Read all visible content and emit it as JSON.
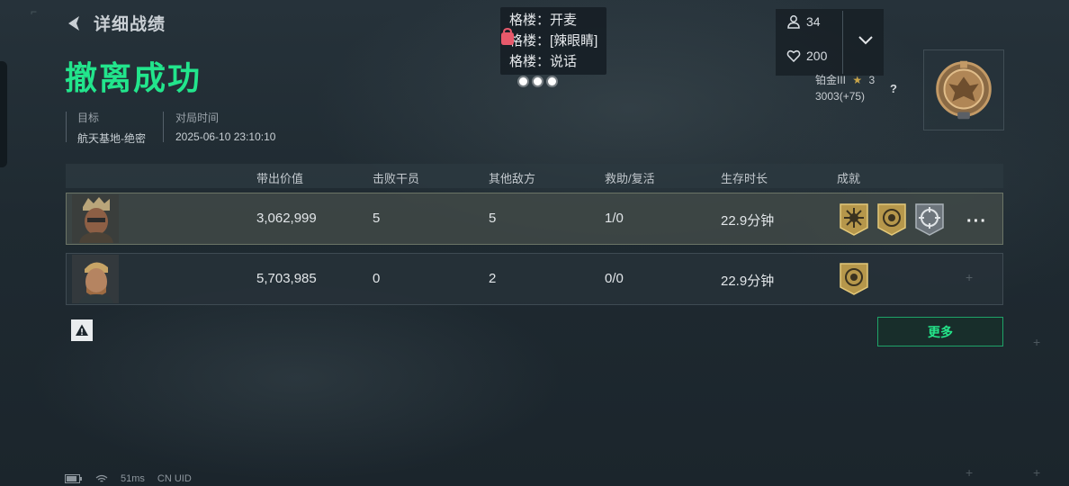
{
  "header": {
    "back_title": "详细战绩",
    "result": "撤离成功"
  },
  "meta": {
    "target_label": "目标",
    "target_value": "航天基地-绝密",
    "time_label": "对局时间",
    "time_value": "2025-06-10 23:10:10"
  },
  "chat": {
    "lines": [
      "格楼：开麦",
      "格楼：[辣眼睛]",
      "格楼：说话"
    ]
  },
  "social": {
    "players": "34",
    "likes": "200"
  },
  "rank": {
    "tier": "铂金III",
    "stars": "3",
    "score": "3003(+75)",
    "help": "?"
  },
  "table": {
    "headers": [
      "带出价值",
      "击败干员",
      "其他敌方",
      "救助/复活",
      "生存时长",
      "成就"
    ],
    "rows": [
      {
        "value": "3,062,999",
        "kills": "5",
        "others": "5",
        "assists": "1/0",
        "survival": "22.9分钟"
      },
      {
        "value": "5,703,985",
        "kills": "0",
        "others": "2",
        "assists": "0/0",
        "survival": "22.9分钟"
      }
    ]
  },
  "buttons": {
    "more": "更多",
    "row_menu": "···"
  },
  "footer": {
    "ping": "51ms",
    "uid": "CN UID"
  },
  "colors": {
    "accent": "#22e58c",
    "gold": "#c9a54a"
  },
  "icons": [
    "back-arrow-icon",
    "person-icon",
    "heart-icon",
    "chevron-down-icon",
    "star-icon",
    "medal-icon",
    "warning-icon",
    "wifi-icon",
    "battery-icon"
  ]
}
